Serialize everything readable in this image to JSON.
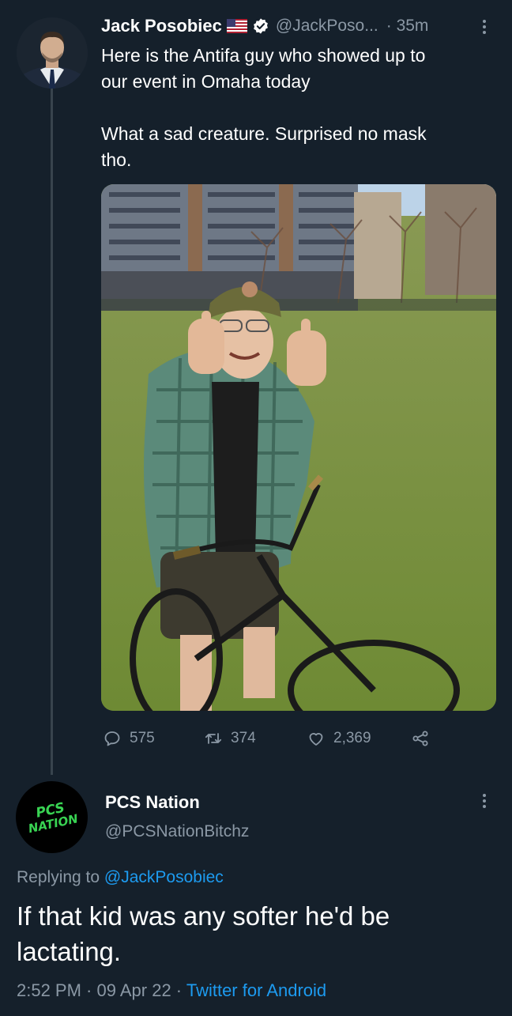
{
  "tweet": {
    "author_name": "Jack Posobiec",
    "flag": "🇺🇸",
    "handle": "@JackPoso...",
    "time": "· 35m",
    "text_line1": "Here is the Antifa guy who showed up to",
    "text_line2": "our event in Omaha today",
    "text_line3": "What a sad creature. Surprised no mask",
    "text_line4": "tho.",
    "stats": {
      "replies": "575",
      "retweets": "374",
      "likes": "2,369"
    }
  },
  "reply": {
    "author_name": "PCS Nation",
    "handle": "@PCSNationBitchz",
    "avatar_text_1": "PCS",
    "avatar_text_2": "NATION",
    "replying_prefix": "Replying to ",
    "replying_handle": "@JackPosobiec",
    "text_line1": "If that kid was any softer he'd be",
    "text_line2": "lactating.",
    "time": "2:52 PM",
    "date_sep": " · ",
    "date": "09 Apr 22",
    "client": "Twitter for Android"
  },
  "colors": {
    "background": "#15202b",
    "muted": "#8b98a5",
    "link": "#1d9bf0",
    "avatar_green": "#39d353"
  },
  "icons": [
    "verified-badge-icon",
    "more-icon",
    "reply-icon",
    "retweet-icon",
    "like-icon",
    "share-icon",
    "flag-icon"
  ]
}
